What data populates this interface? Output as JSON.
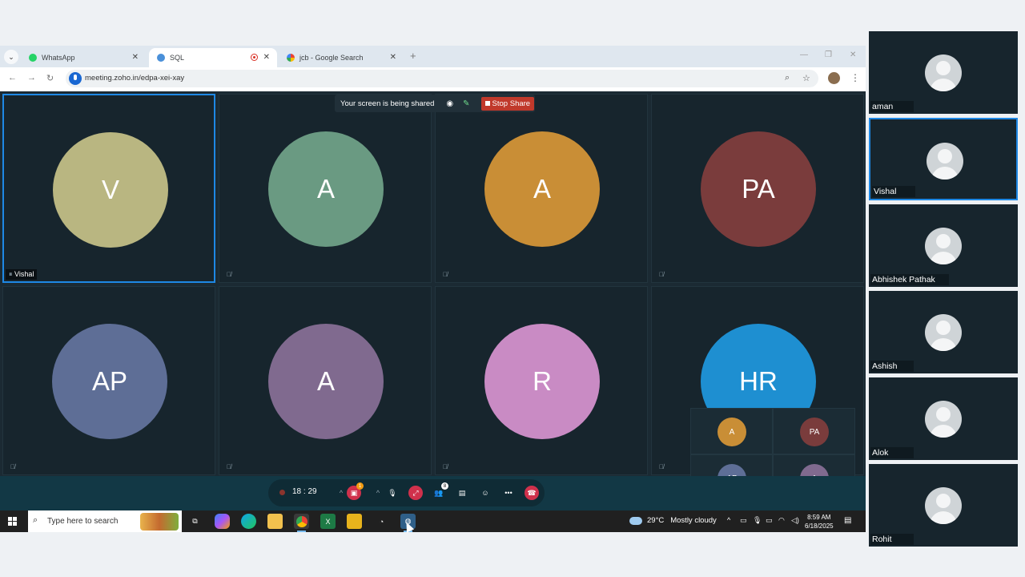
{
  "browser": {
    "tabs": [
      {
        "label": "WhatsApp",
        "active": false
      },
      {
        "label": "SQL",
        "active": true
      },
      {
        "label": "jcb - Google Search",
        "active": false
      }
    ],
    "url": "meeting.zoho.in/edpa-xei-xay"
  },
  "banner": {
    "text": "Your screen is being shared",
    "stop_label": "Stop Share"
  },
  "tiles": [
    {
      "initials": "V",
      "color": "#b9b681",
      "name": "Vishal"
    },
    {
      "initials": "A",
      "color": "#6a9a82"
    },
    {
      "initials": "A",
      "color": "#c98e36"
    },
    {
      "initials": "PA",
      "color": "#7a3c3c"
    },
    {
      "initials": "AP",
      "color": "#5e6e96"
    },
    {
      "initials": "A",
      "color": "#806a8f"
    },
    {
      "initials": "R",
      "color": "#c98bc4"
    },
    {
      "initials": "HR",
      "color": "#1e8fd1"
    }
  ],
  "mini": [
    {
      "initials": "A",
      "color": "#c98e36"
    },
    {
      "initials": "PA",
      "color": "#7a3c3c"
    },
    {
      "initials": "AP",
      "color": "#5e6e96"
    },
    {
      "initials": "A",
      "color": "#806a8f"
    }
  ],
  "controls": {
    "timer": "18 : 29",
    "video_badge": "1",
    "participants_badge": "8"
  },
  "sidebar": [
    {
      "name": "aman"
    },
    {
      "name": "Vishal"
    },
    {
      "name": "Abhishek Pathak"
    },
    {
      "name": "Ashish"
    },
    {
      "name": "Alok"
    },
    {
      "name": "Rohit"
    }
  ],
  "taskbar": {
    "search_placeholder": "Type here to search",
    "temperature": "29°C",
    "weather": "Mostly cloudy",
    "time": "8:59 AM",
    "date": "6/18/2025"
  }
}
